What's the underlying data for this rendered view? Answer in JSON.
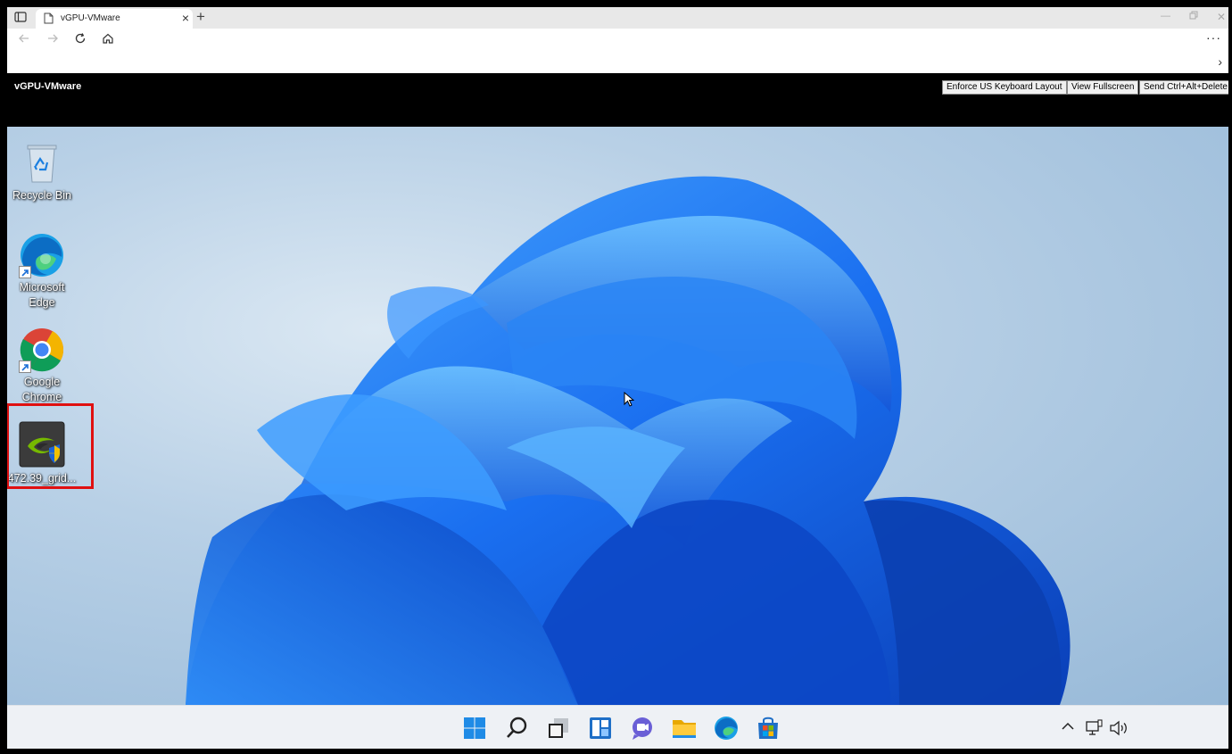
{
  "browser": {
    "tab_title": "vGPU-VMware",
    "new_tab_symbol": "+",
    "close_symbol": "×",
    "more_symbol": "···",
    "expand_symbol": "›"
  },
  "vmware": {
    "title": "vGPU-VMware",
    "buttons": {
      "enforce_keyboard": "Enforce US Keyboard Layout",
      "fullscreen": "View Fullscreen",
      "ctrl_alt_del": "Send Ctrl+Alt+Delete"
    }
  },
  "desktop": {
    "icons": [
      {
        "label": "Recycle Bin",
        "icon": "recycle-bin-icon"
      },
      {
        "label": "Microsoft Edge",
        "icon": "edge-icon"
      },
      {
        "label": "Google Chrome",
        "icon": "chrome-icon"
      },
      {
        "label": "472.39_grid...",
        "icon": "nvidia-installer-icon"
      }
    ],
    "highlight_color": "#e01010"
  },
  "taskbar": {
    "apps": [
      "start-icon",
      "search-icon",
      "task-view-icon",
      "widgets-icon",
      "chat-icon",
      "file-explorer-icon",
      "edge-icon",
      "store-icon"
    ],
    "tray": [
      "chevron-up-icon",
      "network-icon",
      "volume-icon"
    ]
  }
}
